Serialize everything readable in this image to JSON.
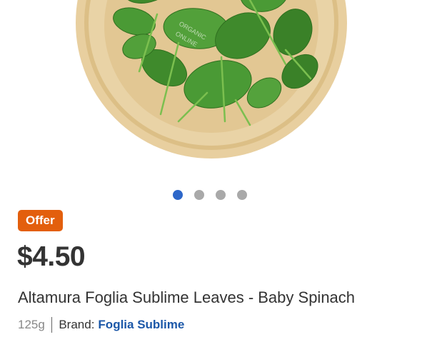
{
  "product": {
    "image": {
      "icon": "baby-spinach-bowl-image",
      "watermark": "ORGANIC ONLINE"
    },
    "carousel": {
      "total": 4,
      "active_index": 0
    },
    "badge": "Offer",
    "price": "$4.50",
    "name": "Altamura Foglia Sublime Leaves - Baby Spinach",
    "weight": "125g",
    "brand_label": "Brand:",
    "brand_name": "Foglia Sublime"
  },
  "colors": {
    "offer_badge": "#e35f0d",
    "dot_active": "#2d67c9",
    "dot_inactive": "#a9a9a9",
    "brand_link": "#1c58a8"
  }
}
